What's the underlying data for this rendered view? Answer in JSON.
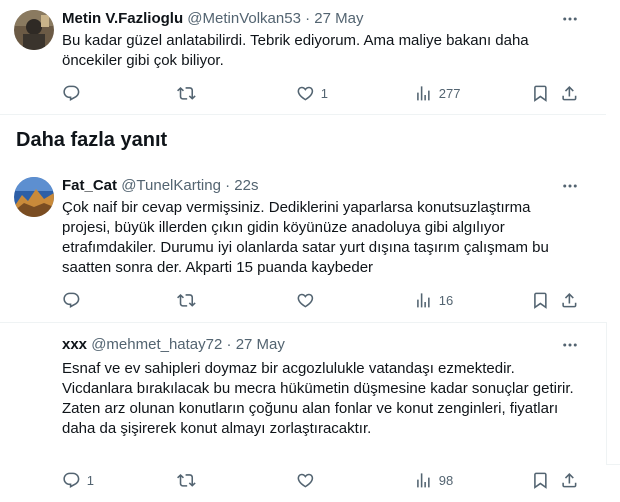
{
  "tweets": [
    {
      "name": "Metin V.Fazlioglu",
      "handle": "@MetinVolkan53",
      "sep": " · ",
      "time": "27 May",
      "text": "Bu kadar güzel anlatabilirdi. Tebrik ediyorum. Ama maliye bakanı daha öncekiler gibi çok biliyor.",
      "replies": "",
      "retweets": "",
      "likes": "1",
      "views": "277"
    },
    {
      "name": "Fat_Cat",
      "handle": "@TunelKarting",
      "sep": " · ",
      "time": "22s",
      "text": "Çok naif bir cevap vermişsiniz. Dediklerini yaparlarsa konutsuzlaştırma projesi, büyük illerden çıkın gidin köyünüze anadoluya gibi algılıyor etrafımdakiler. Durumu iyi olanlarda satar yurt dışına taşırım çalışmam bu saatten sonra der. Akparti 15 puanda kaybeder",
      "replies": "",
      "retweets": "",
      "likes": "",
      "views": "16"
    },
    {
      "name": "xxx",
      "handle": "@mehmet_hatay72",
      "sep": " · ",
      "time": "27 May",
      "text": "Esnaf ve ev sahipleri doymaz bir acgozlulukle vatandaşı ezmektedir.\nVicdanlara bırakılacak bu mecra hükümetin düşmesine kadar sonuçlar getirir.\nZaten arz olunan konutların çoğunu alan fonlar ve konut zenginleri, fiyatları daha da şişirerek konut almayı zorlaştıracaktır.",
      "replies": "1",
      "retweets": "",
      "likes": "",
      "views": "98"
    }
  ],
  "section": {
    "title": "Daha fazla yanıt"
  },
  "icons": [
    "more-icon",
    "reply-icon",
    "retweet-icon",
    "like-icon",
    "views-icon",
    "bookmark-icon",
    "share-icon"
  ]
}
